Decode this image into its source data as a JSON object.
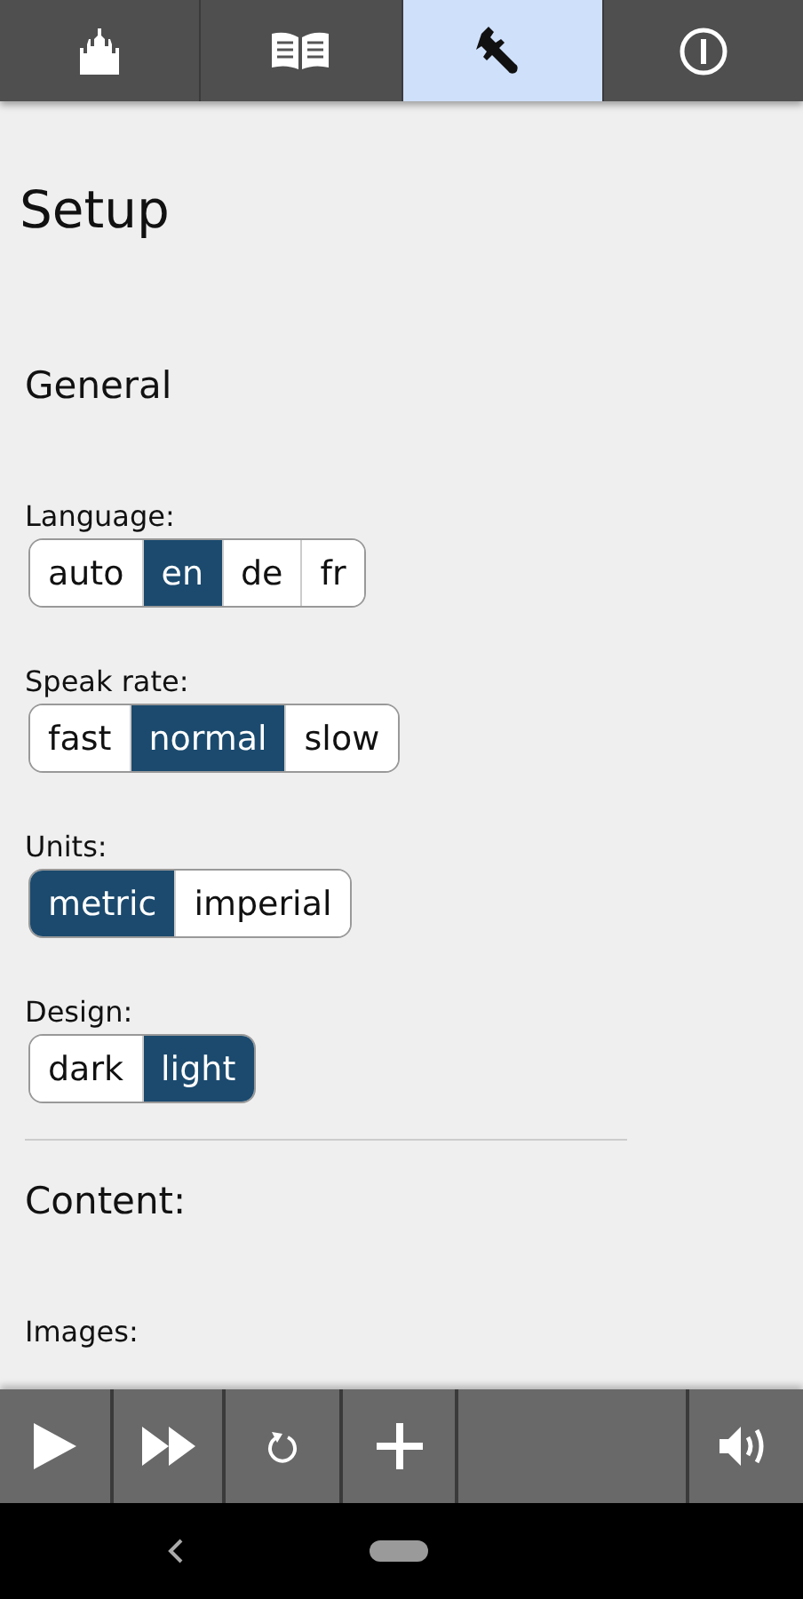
{
  "tabs": [
    {
      "kind": "castle",
      "selected": false
    },
    {
      "kind": "book",
      "selected": false
    },
    {
      "kind": "wrench",
      "selected": true
    },
    {
      "kind": "info",
      "selected": false
    }
  ],
  "title": "Setup",
  "sections": [
    {
      "heading": "General",
      "settings": [
        {
          "label": "Language:",
          "options": [
            {
              "label": "auto",
              "selected": false
            },
            {
              "label": "en",
              "selected": true
            },
            {
              "label": "de",
              "selected": false
            },
            {
              "label": "fr",
              "selected": false
            }
          ]
        },
        {
          "label": "Speak rate:",
          "options": [
            {
              "label": "fast",
              "selected": false
            },
            {
              "label": "normal",
              "selected": true
            },
            {
              "label": "slow",
              "selected": false
            }
          ]
        },
        {
          "label": "Units:",
          "options": [
            {
              "label": "metric",
              "selected": true
            },
            {
              "label": "imperial",
              "selected": false
            }
          ]
        },
        {
          "label": "Design:",
          "options": [
            {
              "label": "dark",
              "selected": false
            },
            {
              "label": "light",
              "selected": true
            }
          ]
        }
      ]
    },
    {
      "heading": "Content:",
      "settings": [
        {
          "label": "Images:"
        }
      ]
    }
  ],
  "player": [
    {
      "kind": "play"
    },
    {
      "kind": "fast-forward"
    },
    {
      "kind": "reload"
    },
    {
      "kind": "plus"
    },
    {
      "kind": "empty"
    },
    {
      "kind": "speaker"
    }
  ]
}
